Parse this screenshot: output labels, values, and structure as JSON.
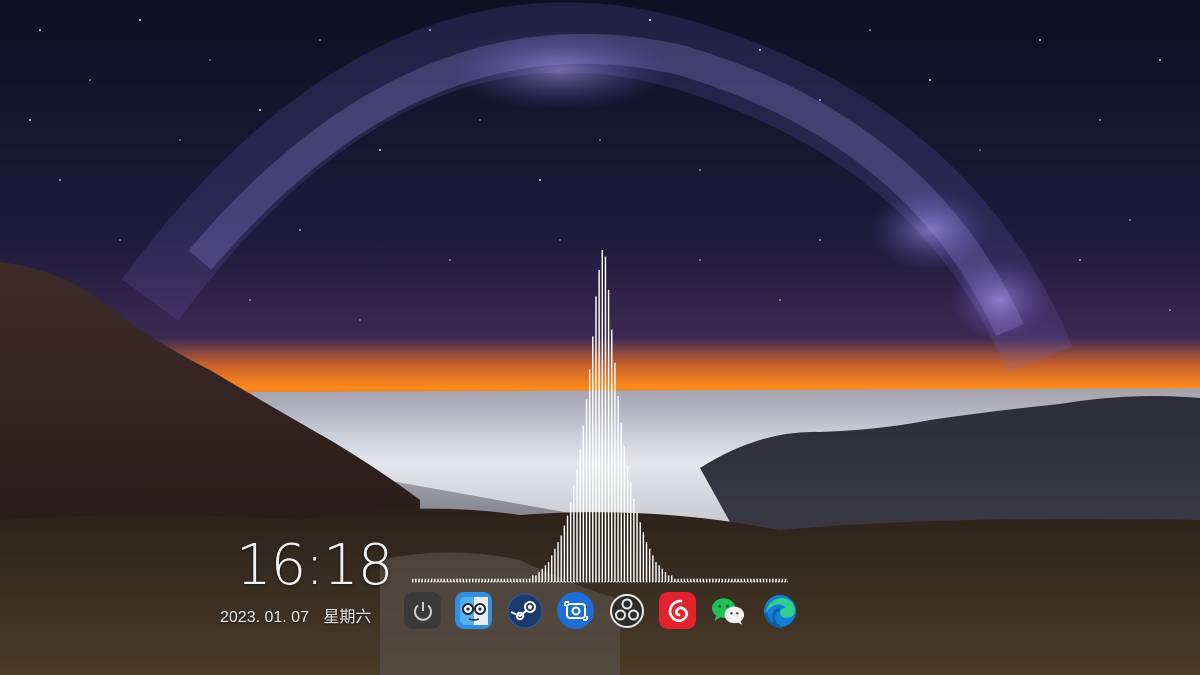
{
  "clock": {
    "time": "16:18",
    "date": "2023. 01. 07",
    "weekday": "星期六"
  },
  "audio_visualizer": {
    "bar_color": "#ffffff",
    "levels": [
      0.01,
      0.01,
      0.01,
      0.01,
      0.01,
      0.01,
      0.01,
      0.01,
      0.01,
      0.01,
      0.01,
      0.01,
      0.01,
      0.01,
      0.01,
      0.01,
      0.01,
      0.01,
      0.01,
      0.01,
      0.01,
      0.01,
      0.01,
      0.01,
      0.01,
      0.01,
      0.01,
      0.01,
      0.01,
      0.01,
      0.01,
      0.01,
      0.01,
      0.01,
      0.01,
      0.01,
      0.01,
      0.01,
      0.02,
      0.02,
      0.03,
      0.04,
      0.05,
      0.06,
      0.08,
      0.1,
      0.12,
      0.14,
      0.17,
      0.2,
      0.24,
      0.29,
      0.34,
      0.4,
      0.47,
      0.55,
      0.64,
      0.74,
      0.86,
      0.94,
      1.0,
      0.98,
      0.88,
      0.76,
      0.66,
      0.56,
      0.48,
      0.41,
      0.35,
      0.3,
      0.25,
      0.21,
      0.18,
      0.15,
      0.12,
      0.1,
      0.08,
      0.06,
      0.05,
      0.04,
      0.03,
      0.02,
      0.02,
      0.01,
      0.01,
      0.01,
      0.01,
      0.01,
      0.01,
      0.01,
      0.01,
      0.01,
      0.01,
      0.01,
      0.01,
      0.01,
      0.01,
      0.01,
      0.01,
      0.01,
      0.01,
      0.01,
      0.01,
      0.01,
      0.01,
      0.01,
      0.01,
      0.01,
      0.01,
      0.01,
      0.01,
      0.01,
      0.01,
      0.01,
      0.01,
      0.01,
      0.01,
      0.01,
      0.01
    ]
  },
  "dock": {
    "items": [
      {
        "name": "power",
        "icon": "power-icon",
        "color": "#3a3a3a"
      },
      {
        "name": "face-app",
        "icon": "glasses-face-icon",
        "color": "#2f8fe0"
      },
      {
        "name": "steam",
        "icon": "steam-icon",
        "color": "#1b2838"
      },
      {
        "name": "screenshot",
        "icon": "capture-icon",
        "color": "#1d6fd6"
      },
      {
        "name": "obs",
        "icon": "obs-icon",
        "color": "#2b2b2b"
      },
      {
        "name": "netease-music",
        "icon": "netease-music-icon",
        "color": "#e0232d"
      },
      {
        "name": "wechat",
        "icon": "wechat-icon",
        "color": "#19b955"
      },
      {
        "name": "edge",
        "icon": "edge-icon",
        "color": "#1180d6"
      }
    ]
  }
}
